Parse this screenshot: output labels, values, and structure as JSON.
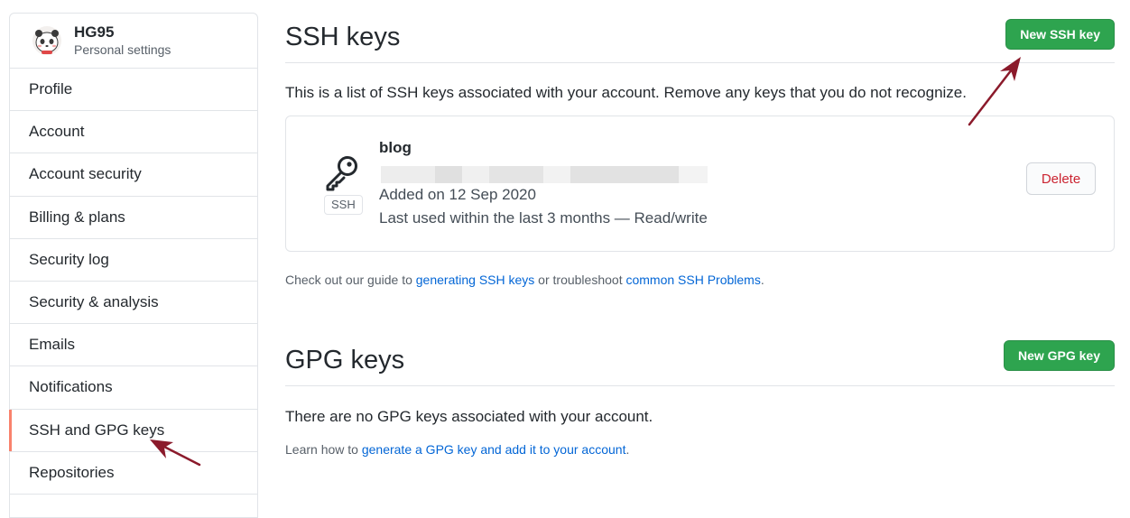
{
  "sidebar": {
    "user": {
      "name": "HG95",
      "subtitle": "Personal settings"
    },
    "items": [
      {
        "label": "Profile"
      },
      {
        "label": "Account"
      },
      {
        "label": "Account security"
      },
      {
        "label": "Billing & plans"
      },
      {
        "label": "Security log"
      },
      {
        "label": "Security & analysis"
      },
      {
        "label": "Emails"
      },
      {
        "label": "Notifications"
      },
      {
        "label": "SSH and GPG keys",
        "active": true
      },
      {
        "label": "Repositories"
      }
    ]
  },
  "ssh": {
    "title": "SSH keys",
    "new_button": "New SSH key",
    "intro": "This is a list of SSH keys associated with your account. Remove any keys that you do not recognize.",
    "key": {
      "title": "blog",
      "badge": "SSH",
      "added": "Added on 12 Sep 2020",
      "last_used": "Last used within the last 3 months — Read/write",
      "delete_button": "Delete"
    },
    "guide": {
      "prefix": "Check out our guide to ",
      "link1": "generating SSH keys",
      "middle": " or troubleshoot ",
      "link2": "common SSH Problems",
      "suffix": "."
    }
  },
  "gpg": {
    "title": "GPG keys",
    "new_button": "New GPG key",
    "none_text": "There are no GPG keys associated with your account.",
    "learn": {
      "prefix": "Learn how to ",
      "link": "generate a GPG key and add it to your account",
      "suffix": "."
    }
  },
  "colors": {
    "primary_button": "#2ea44f",
    "link": "#0366d6",
    "danger": "#cb2431",
    "active_marker": "#f9826c",
    "annotation_arrow": "#8b1a2b"
  },
  "icons": {
    "avatar": "panda-avatar",
    "key": "key-icon"
  }
}
